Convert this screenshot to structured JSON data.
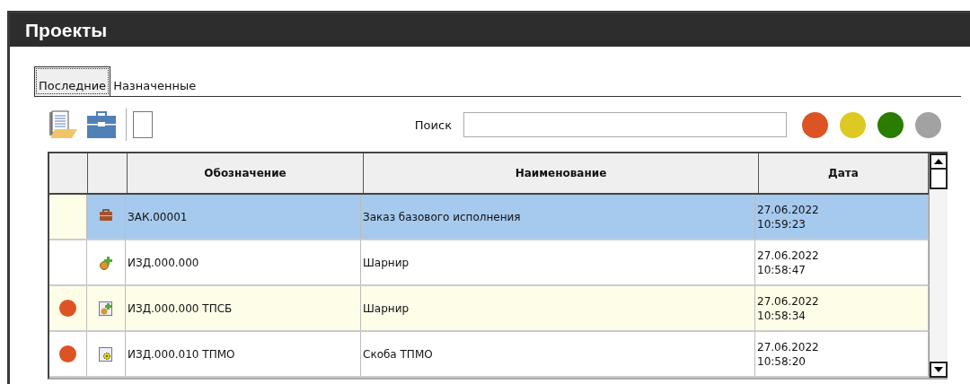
{
  "window": {
    "title": "Проекты"
  },
  "tabs": [
    {
      "label": "Последние",
      "selected": true
    },
    {
      "label": "Назначенные",
      "selected": false
    }
  ],
  "toolbar": {
    "buttons": [
      {
        "kind": "document-folder"
      },
      {
        "kind": "briefcase"
      },
      {
        "kind": "blank"
      }
    ],
    "search": {
      "label": "Поиск"
    },
    "filters": [
      {
        "color": "#dc5324"
      },
      {
        "color": "#dcc924"
      },
      {
        "color": "#2a7c03"
      },
      {
        "color": "#a2a2a2"
      }
    ]
  },
  "table": {
    "columns": [
      "Обозначение",
      "Наименование",
      "Дата"
    ],
    "rows": [
      {
        "kind": "briefcase",
        "code": "ЗАК.00001",
        "name": "Заказ базового исполнения",
        "date": "27.06.2022",
        "time": "10:59:23",
        "selected": true
      },
      {
        "kind": "assembly",
        "code": "ИЗД.000.000",
        "name": "Шарнир",
        "date": "27.06.2022",
        "time": "10:58:47",
        "selected": false
      },
      {
        "color": "#dc5324",
        "kind": "assembly-doc",
        "code": "ИЗД.000.000 ТПСБ",
        "name": "Шарнир",
        "date": "27.06.2022",
        "time": "10:58:34",
        "selected": false
      },
      {
        "color": "#dc5324",
        "kind": "gear-doc",
        "code": "ИЗД.000.010 ТПМО",
        "name": "Скоба ТПМО",
        "date": "27.06.2022",
        "time": "10:58:20",
        "selected": false
      }
    ]
  }
}
